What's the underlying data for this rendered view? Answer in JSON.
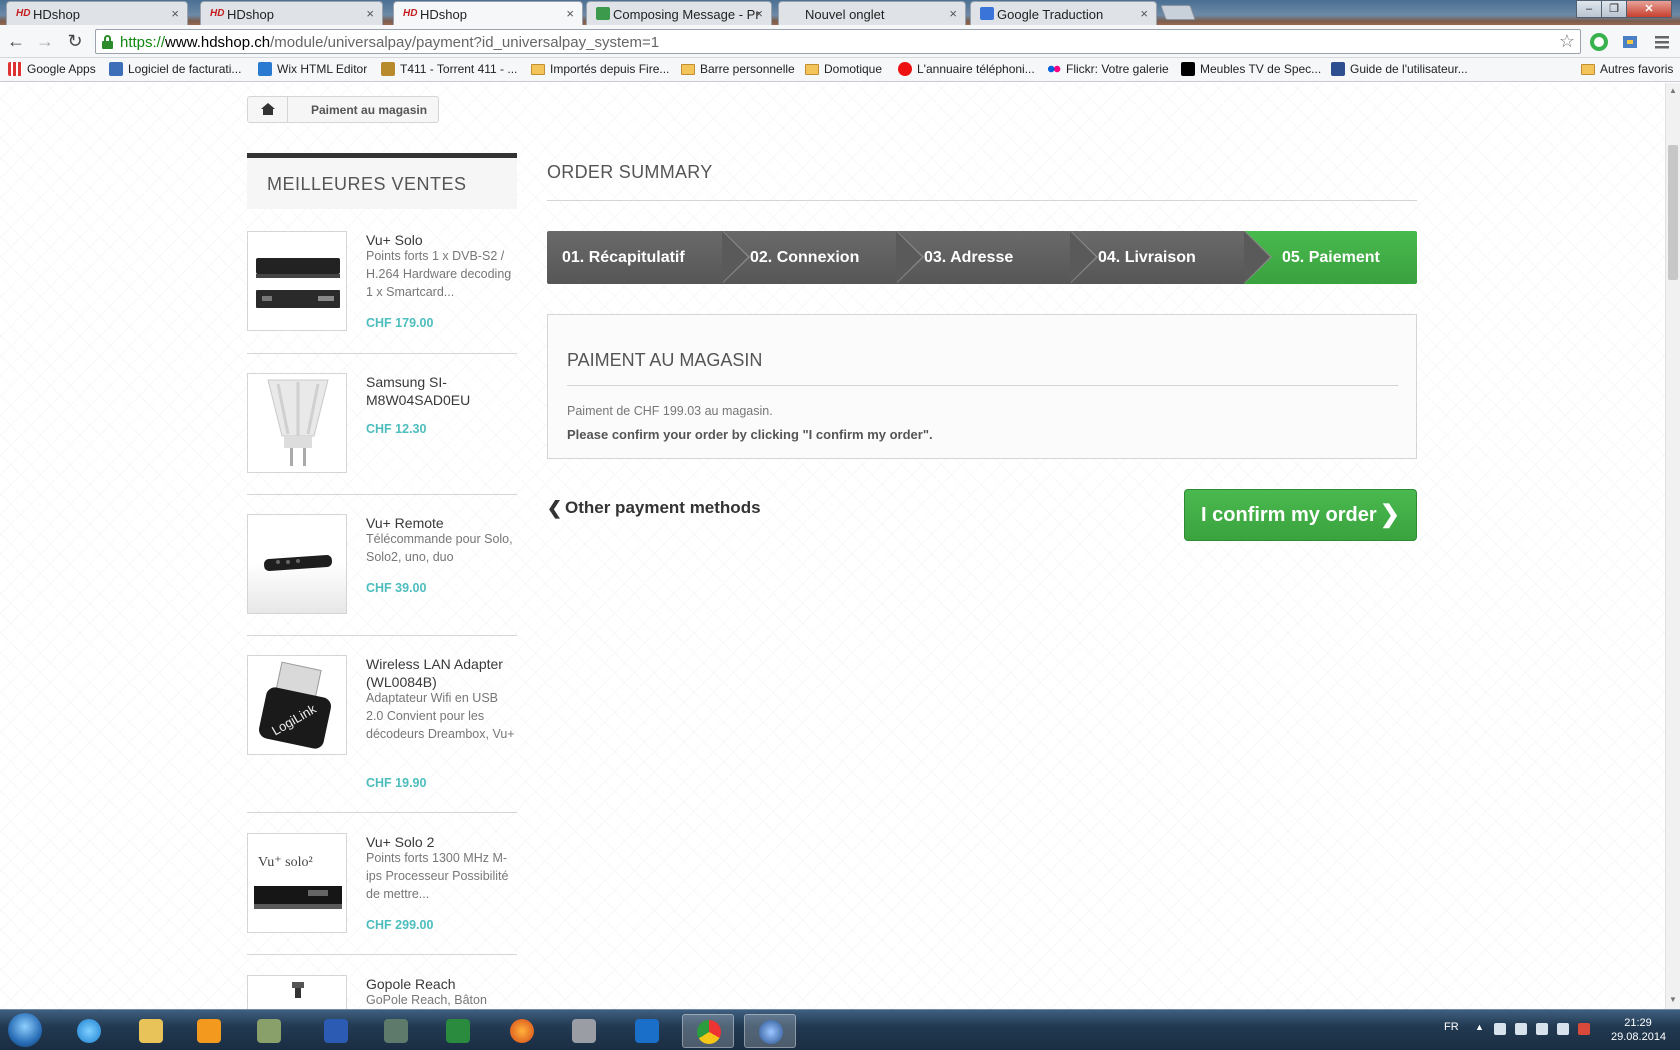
{
  "browser": {
    "tabs": [
      {
        "title": "HDshop",
        "icon": "hdshop-favicon",
        "active": false
      },
      {
        "title": "HDshop",
        "icon": "hdshop-favicon",
        "active": false
      },
      {
        "title": "HDshop",
        "icon": "hdshop-favicon",
        "active": true
      },
      {
        "title": "Composing Message - Pr",
        "icon": "gmail-favicon",
        "active": false
      },
      {
        "title": "Nouvel onglet",
        "icon": "none",
        "active": false
      },
      {
        "title": "Google Traduction",
        "icon": "google-translate-favicon",
        "active": false
      }
    ],
    "url": {
      "scheme": "https://",
      "domain": "www.hdshop.ch",
      "path": "/module/universalpay/payment?id_universalpay_system=1"
    },
    "bookmarks": [
      {
        "label": "Google Apps",
        "icon": "apps-icon"
      },
      {
        "label": "Logiciel de facturati...",
        "icon": "page-icon"
      },
      {
        "label": "Wix HTML Editor",
        "icon": "wix-icon"
      },
      {
        "label": "T411 - Torrent 411 - ...",
        "icon": "t411-icon"
      },
      {
        "label": "Importés depuis Fire...",
        "icon": "folder-icon"
      },
      {
        "label": "Barre personnelle",
        "icon": "folder-icon"
      },
      {
        "label": "Domotique",
        "icon": "folder-icon"
      },
      {
        "label": "L'annuaire téléphoni...",
        "icon": "directory-icon"
      },
      {
        "label": "Flickr: Votre galerie",
        "icon": "flickr-icon"
      },
      {
        "label": "Meubles TV de Spec...",
        "icon": "black-square-icon"
      },
      {
        "label": "Guide de l'utilisateur...",
        "icon": "tools-icon"
      }
    ],
    "other_bookmarks": "Autres favoris"
  },
  "page": {
    "breadcrumb": {
      "current": "Paiment au magasin"
    },
    "sidebar": {
      "title": "MEILLEURES VENTES",
      "products": [
        {
          "name": "Vu+ Solo",
          "desc": "Points forts 1 x DVB-S2 / H.264 Hardware decoding 1 x Smartcard...",
          "price": "CHF 179.00"
        },
        {
          "name": "Samsung SI-M8W04SAD0EU",
          "desc": "",
          "price": "CHF 12.30"
        },
        {
          "name": "Vu+ Remote",
          "desc": "Télécommande pour Solo, Solo2, uno, duo",
          "price": "CHF 39.00"
        },
        {
          "name": "Wireless LAN Adapter (WL0084B)",
          "desc": "Adaptateur Wifi en USB 2.0 Convient pour les décodeurs Dreambox, Vu+",
          "price": "CHF 19.90"
        },
        {
          "name": "Vu+ Solo 2",
          "desc": "Points forts 1300 MHz M-ips Processeur Possibilité de mettre...",
          "price": "CHF 299.00"
        },
        {
          "name": "Gopole Reach",
          "desc": "GoPole Reach, Bâton",
          "price": ""
        }
      ]
    },
    "main": {
      "title": "ORDER SUMMARY",
      "steps": [
        {
          "label": "01. Récapitulatif",
          "active": false
        },
        {
          "label": "02. Connexion",
          "active": false
        },
        {
          "label": "03. Adresse",
          "active": false
        },
        {
          "label": "04. Livraison",
          "active": false
        },
        {
          "label": "05. Paiement",
          "active": true
        }
      ],
      "payment": {
        "heading": "PAIMENT AU MAGASIN",
        "line1": "Paiment de CHF 199.03 au magasin.",
        "line2": "Please confirm your order by clicking \"I confirm my order\"."
      },
      "other_methods": "Other payment methods",
      "confirm": "I confirm my order"
    }
  },
  "taskbar": {
    "lang": "FR",
    "time": "21:29",
    "date": "29.08.2014"
  },
  "colors": {
    "accent_green": "#46a74e",
    "step_grey": "#5f5f5f",
    "price_teal": "#4dbdbd"
  }
}
